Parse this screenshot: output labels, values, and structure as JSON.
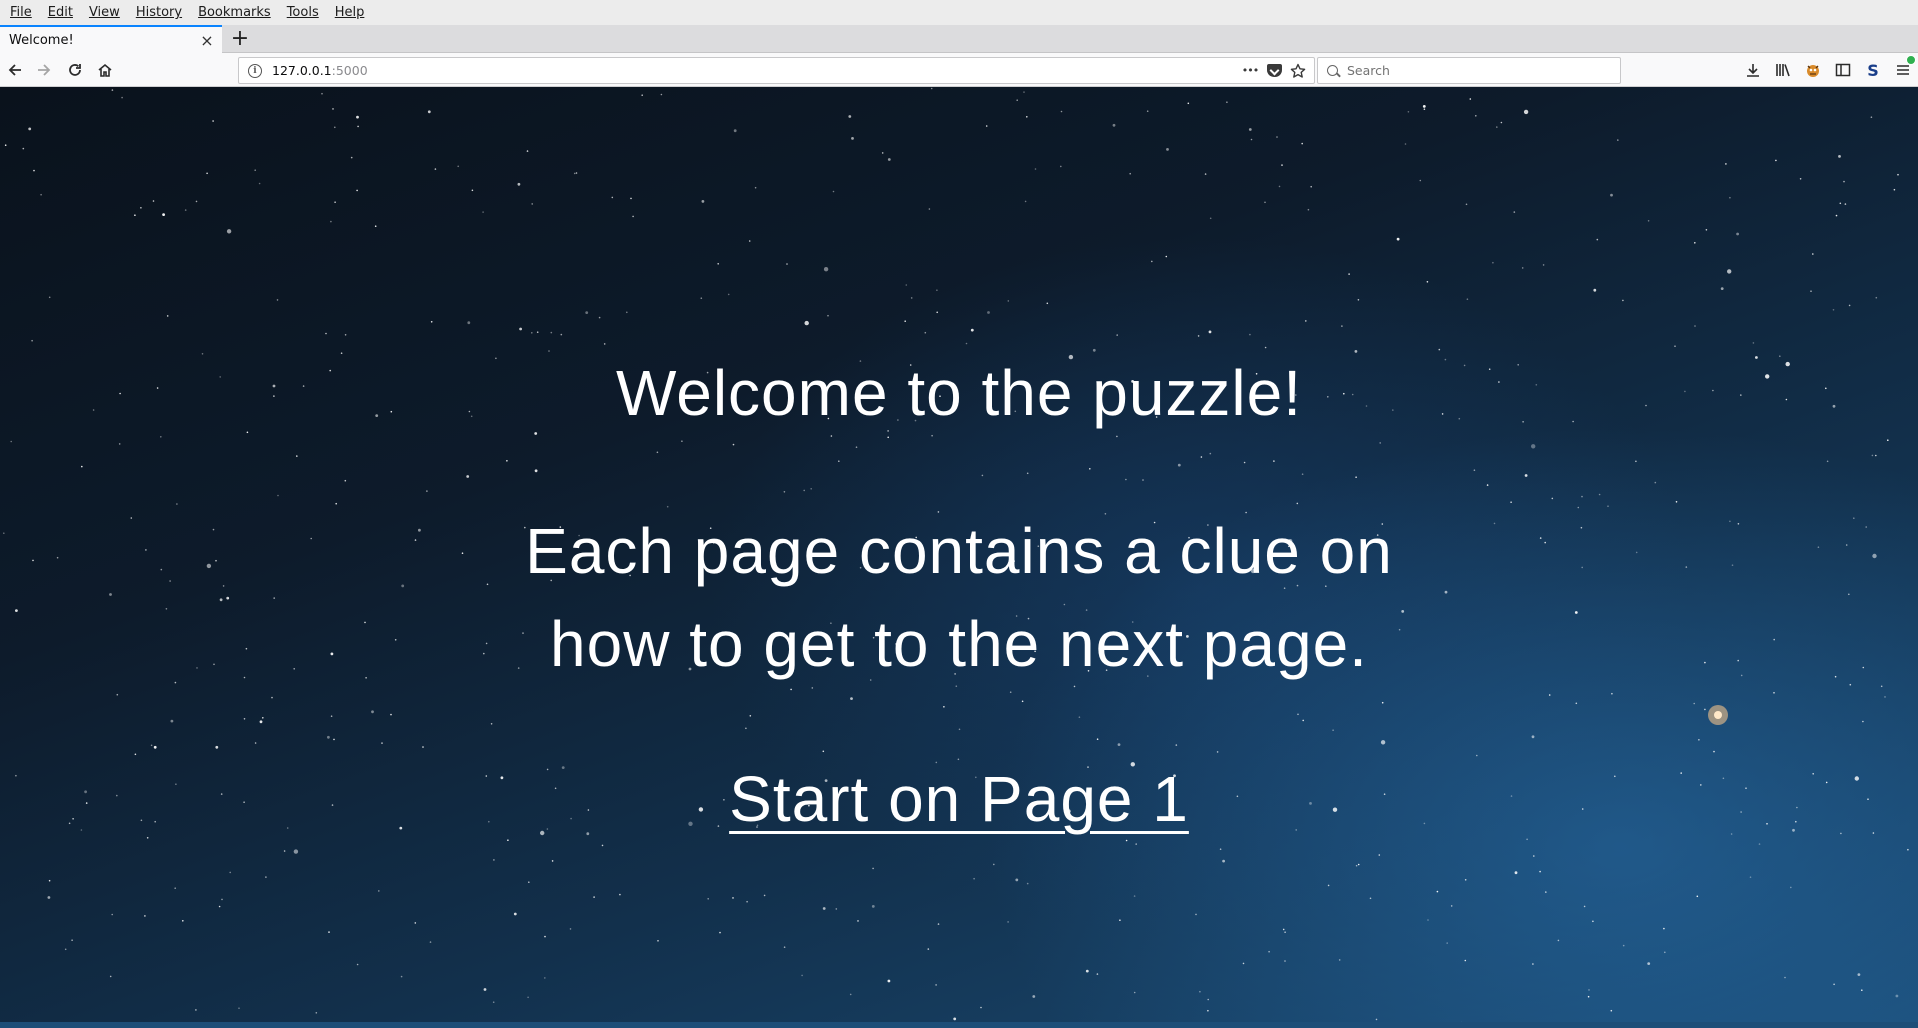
{
  "menubar": {
    "items": [
      {
        "label": "File",
        "name": "menu-file"
      },
      {
        "label": "Edit",
        "name": "menu-edit"
      },
      {
        "label": "View",
        "name": "menu-view"
      },
      {
        "label": "History",
        "name": "menu-history"
      },
      {
        "label": "Bookmarks",
        "name": "menu-bookmarks"
      },
      {
        "label": "Tools",
        "name": "menu-tools"
      },
      {
        "label": "Help",
        "name": "menu-help"
      }
    ]
  },
  "tab": {
    "title": "Welcome!",
    "close_glyph": "×"
  },
  "new_tab_glyph": "+",
  "nav": {
    "back_icon": "back-arrow-icon",
    "forward_icon": "forward-arrow-icon",
    "reload_icon": "reload-icon",
    "home_icon": "home-icon"
  },
  "urlbar": {
    "host": "127.0.0.1",
    "port": ":5000",
    "actions_glyph": "•••"
  },
  "search": {
    "placeholder": "Search"
  },
  "toolbar_icons": [
    "downloads-icon",
    "library-icon",
    "extension-icon",
    "sidebar-icon",
    "s-extension-icon",
    "menu-icon"
  ],
  "s_extension_label": "S",
  "page": {
    "heading": "Welcome to the puzzle!",
    "clue_line1": "Each page contains a clue on",
    "clue_line2": "how to get to the next page.",
    "start_link": "Start on Page 1"
  },
  "colors": {
    "accent_tab": "#0a84ff",
    "link": "#ffffff",
    "background": "#0d1b2b"
  }
}
